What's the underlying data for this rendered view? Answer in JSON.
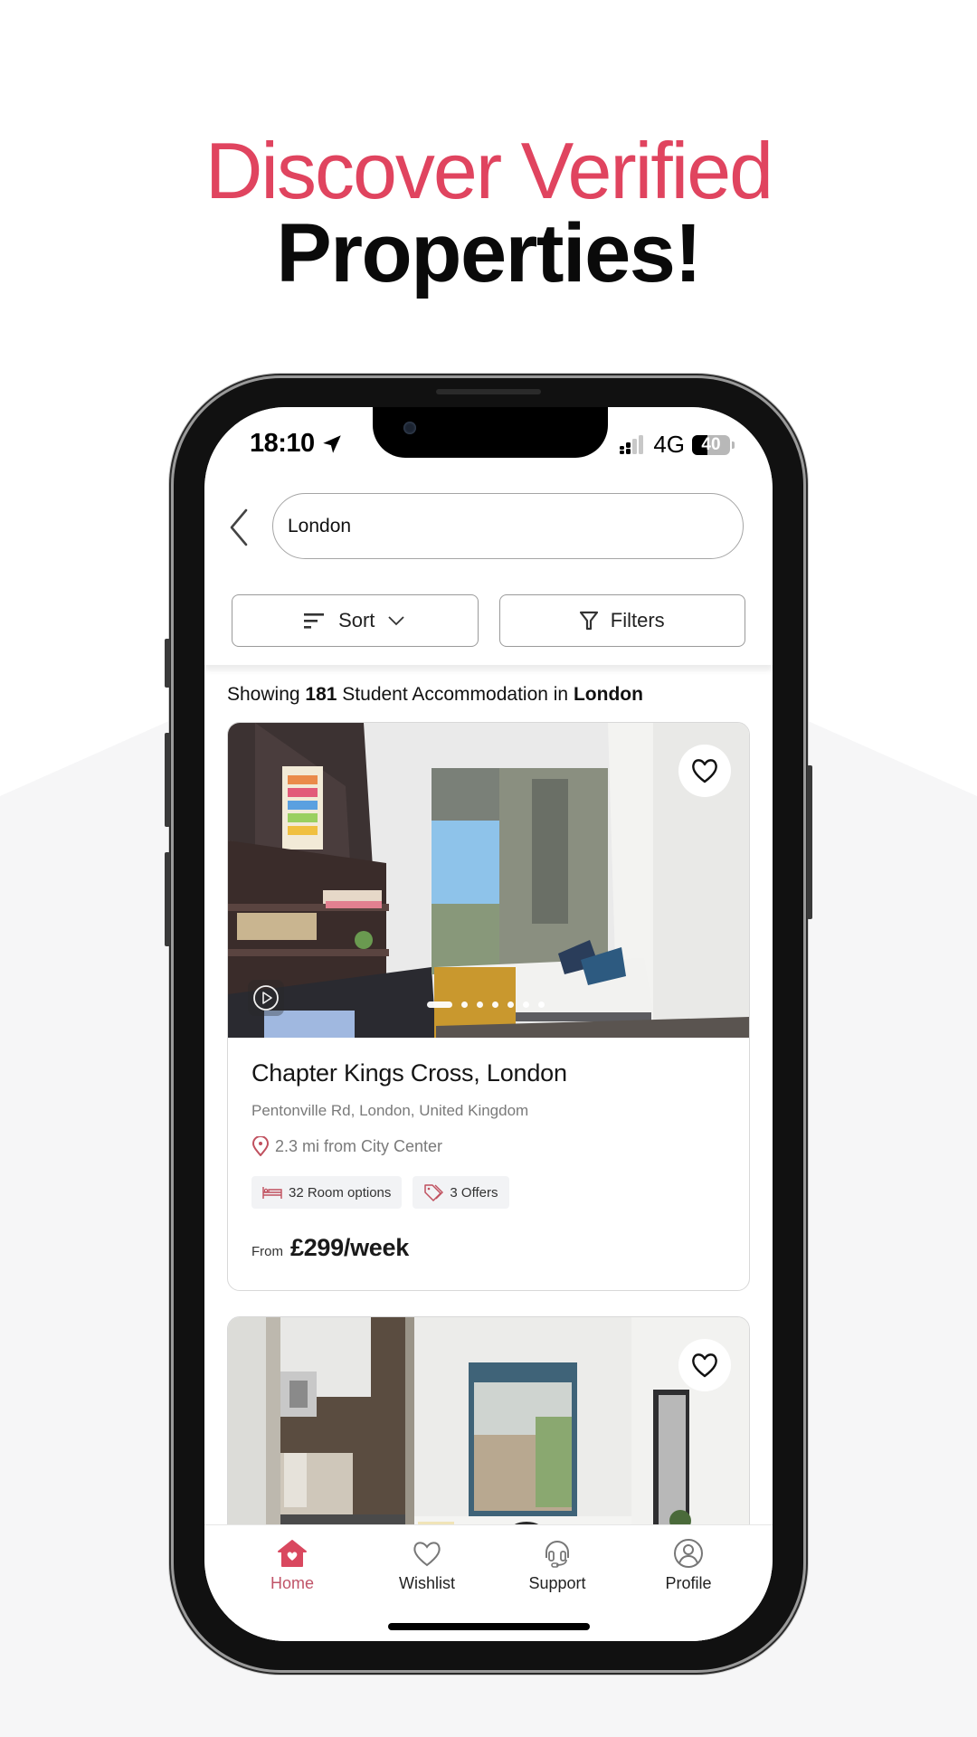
{
  "hero": {
    "line1": "Discover Verified",
    "line2": "Properties!",
    "accent_color": "#e0445f"
  },
  "status_bar": {
    "time": "18:10",
    "location_icon": "location-arrow-icon",
    "network": "4G",
    "battery": "40",
    "battery_level_percent": 40
  },
  "search": {
    "value": "London",
    "back_icon": "chevron-left-icon"
  },
  "toolbar": {
    "sort_label": "Sort",
    "filters_label": "Filters"
  },
  "results": {
    "prefix": "Showing",
    "count": "181",
    "middle": "Student Accommodation in",
    "city": "London"
  },
  "listings": [
    {
      "title": "Chapter Kings Cross, London",
      "address": "Pentonville Rd, London, United Kingdom",
      "distance": "2.3 mi from City Center",
      "room_options": "32 Room options",
      "offers": "3 Offers",
      "price_prefix": "From",
      "price": "£299/week",
      "photo_count": 7,
      "active_photo": 1,
      "favorited": false
    },
    {
      "favorited": false
    }
  ],
  "tabbar": {
    "items": [
      {
        "label": "Home",
        "icon": "home-heart-icon",
        "active": true
      },
      {
        "label": "Wishlist",
        "icon": "heart-icon",
        "active": false
      },
      {
        "label": "Support",
        "icon": "headset-icon",
        "active": false
      },
      {
        "label": "Profile",
        "icon": "user-circle-icon",
        "active": false
      }
    ],
    "active_color": "#c05468"
  }
}
